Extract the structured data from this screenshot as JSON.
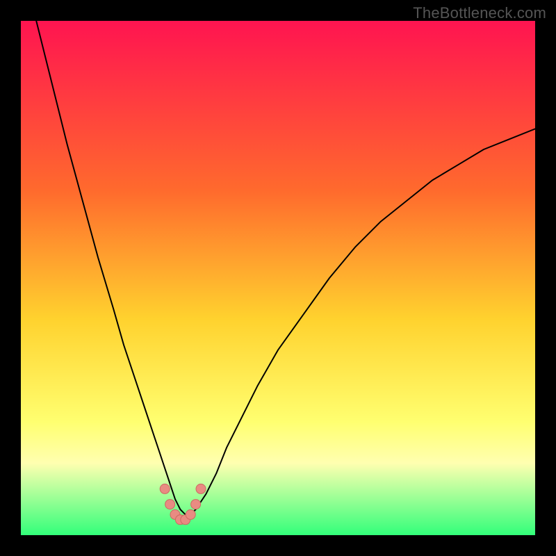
{
  "watermark": "TheBottleneck.com",
  "colors": {
    "frame": "#000000",
    "grad_top": "#ff1450",
    "grad_upper_mid": "#ff6a2d",
    "grad_mid": "#ffd22e",
    "grad_lower_mid": "#ffff70",
    "grad_paleband": "#ffffb0",
    "grad_bottom": "#32ff7a",
    "curve": "#000000",
    "marker_fill": "#e98b82",
    "marker_stroke": "#cc6a62"
  },
  "chart_data": {
    "type": "line",
    "title": "",
    "xlabel": "",
    "ylabel": "",
    "xlim": [
      0,
      100
    ],
    "ylim": [
      0,
      100
    ],
    "series": [
      {
        "name": "bottleneck-curve",
        "x": [
          3,
          6,
          9,
          12,
          15,
          18,
          20,
          22,
          24,
          26,
          27,
          28,
          29,
          30,
          31,
          32,
          33,
          34,
          36,
          38,
          40,
          43,
          46,
          50,
          55,
          60,
          65,
          70,
          75,
          80,
          85,
          90,
          95,
          100
        ],
        "values": [
          100,
          88,
          76,
          65,
          54,
          44,
          37,
          31,
          25,
          19,
          16,
          13,
          10,
          7,
          5,
          4,
          4,
          5,
          8,
          12,
          17,
          23,
          29,
          36,
          43,
          50,
          56,
          61,
          65,
          69,
          72,
          75,
          77,
          79
        ]
      }
    ],
    "markers": {
      "name": "highlight-points",
      "x": [
        28,
        29,
        30,
        31,
        32,
        33,
        34,
        35
      ],
      "values": [
        9,
        6,
        4,
        3,
        3,
        4,
        6,
        9
      ]
    }
  }
}
